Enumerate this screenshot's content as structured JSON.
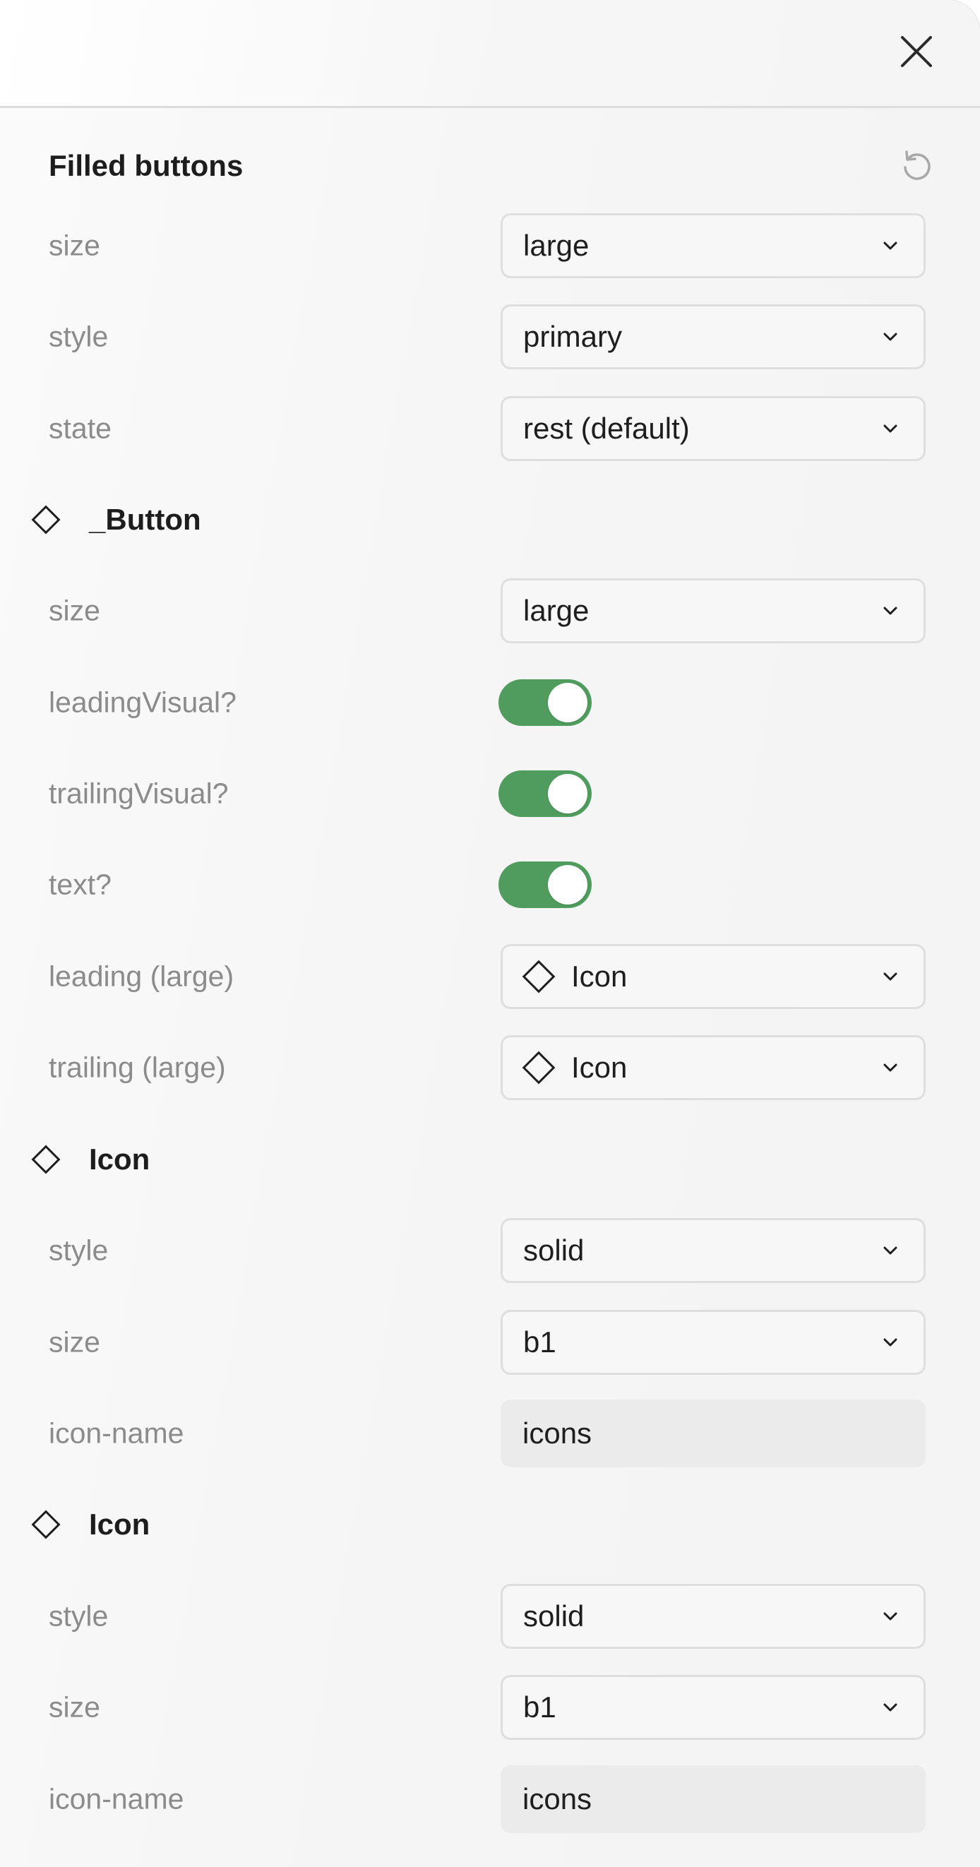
{
  "colors": {
    "toggle_on": "#4f9c5e",
    "label_text": "#8b8b8b",
    "title_text": "#1d1d1d",
    "input_bg": "#ebebeb"
  },
  "header": {
    "close_icon": "close-icon"
  },
  "filled_buttons": {
    "title": "Filled buttons",
    "reset_icon": "reset-icon",
    "props": [
      {
        "label": "size",
        "value": "large"
      },
      {
        "label": "style",
        "value": "primary"
      },
      {
        "label": "state",
        "value": "rest (default)"
      }
    ]
  },
  "button_section": {
    "title": "_Button",
    "icon": "component-diamond-icon",
    "size": {
      "label": "size",
      "value": "large"
    },
    "toggles": [
      {
        "label": "leadingVisual?",
        "on": true
      },
      {
        "label": "trailingVisual?",
        "on": true
      },
      {
        "label": "text?",
        "on": true
      }
    ],
    "leading": {
      "label": "leading (large)",
      "value": "Icon",
      "icon": "component-diamond-icon"
    },
    "trailing": {
      "label": "trailing (large)",
      "value": "Icon",
      "icon": "component-diamond-icon"
    }
  },
  "icon_section_1": {
    "title": "Icon",
    "icon": "component-diamond-icon",
    "style": {
      "label": "style",
      "value": "solid"
    },
    "size": {
      "label": "size",
      "value": "b1"
    },
    "icon_name": {
      "label": "icon-name",
      "value": "icons"
    }
  },
  "icon_section_2": {
    "title": "Icon",
    "icon": "component-diamond-icon",
    "style": {
      "label": "style",
      "value": "solid"
    },
    "size": {
      "label": "size",
      "value": "b1"
    },
    "icon_name": {
      "label": "icon-name",
      "value": "icons"
    }
  }
}
